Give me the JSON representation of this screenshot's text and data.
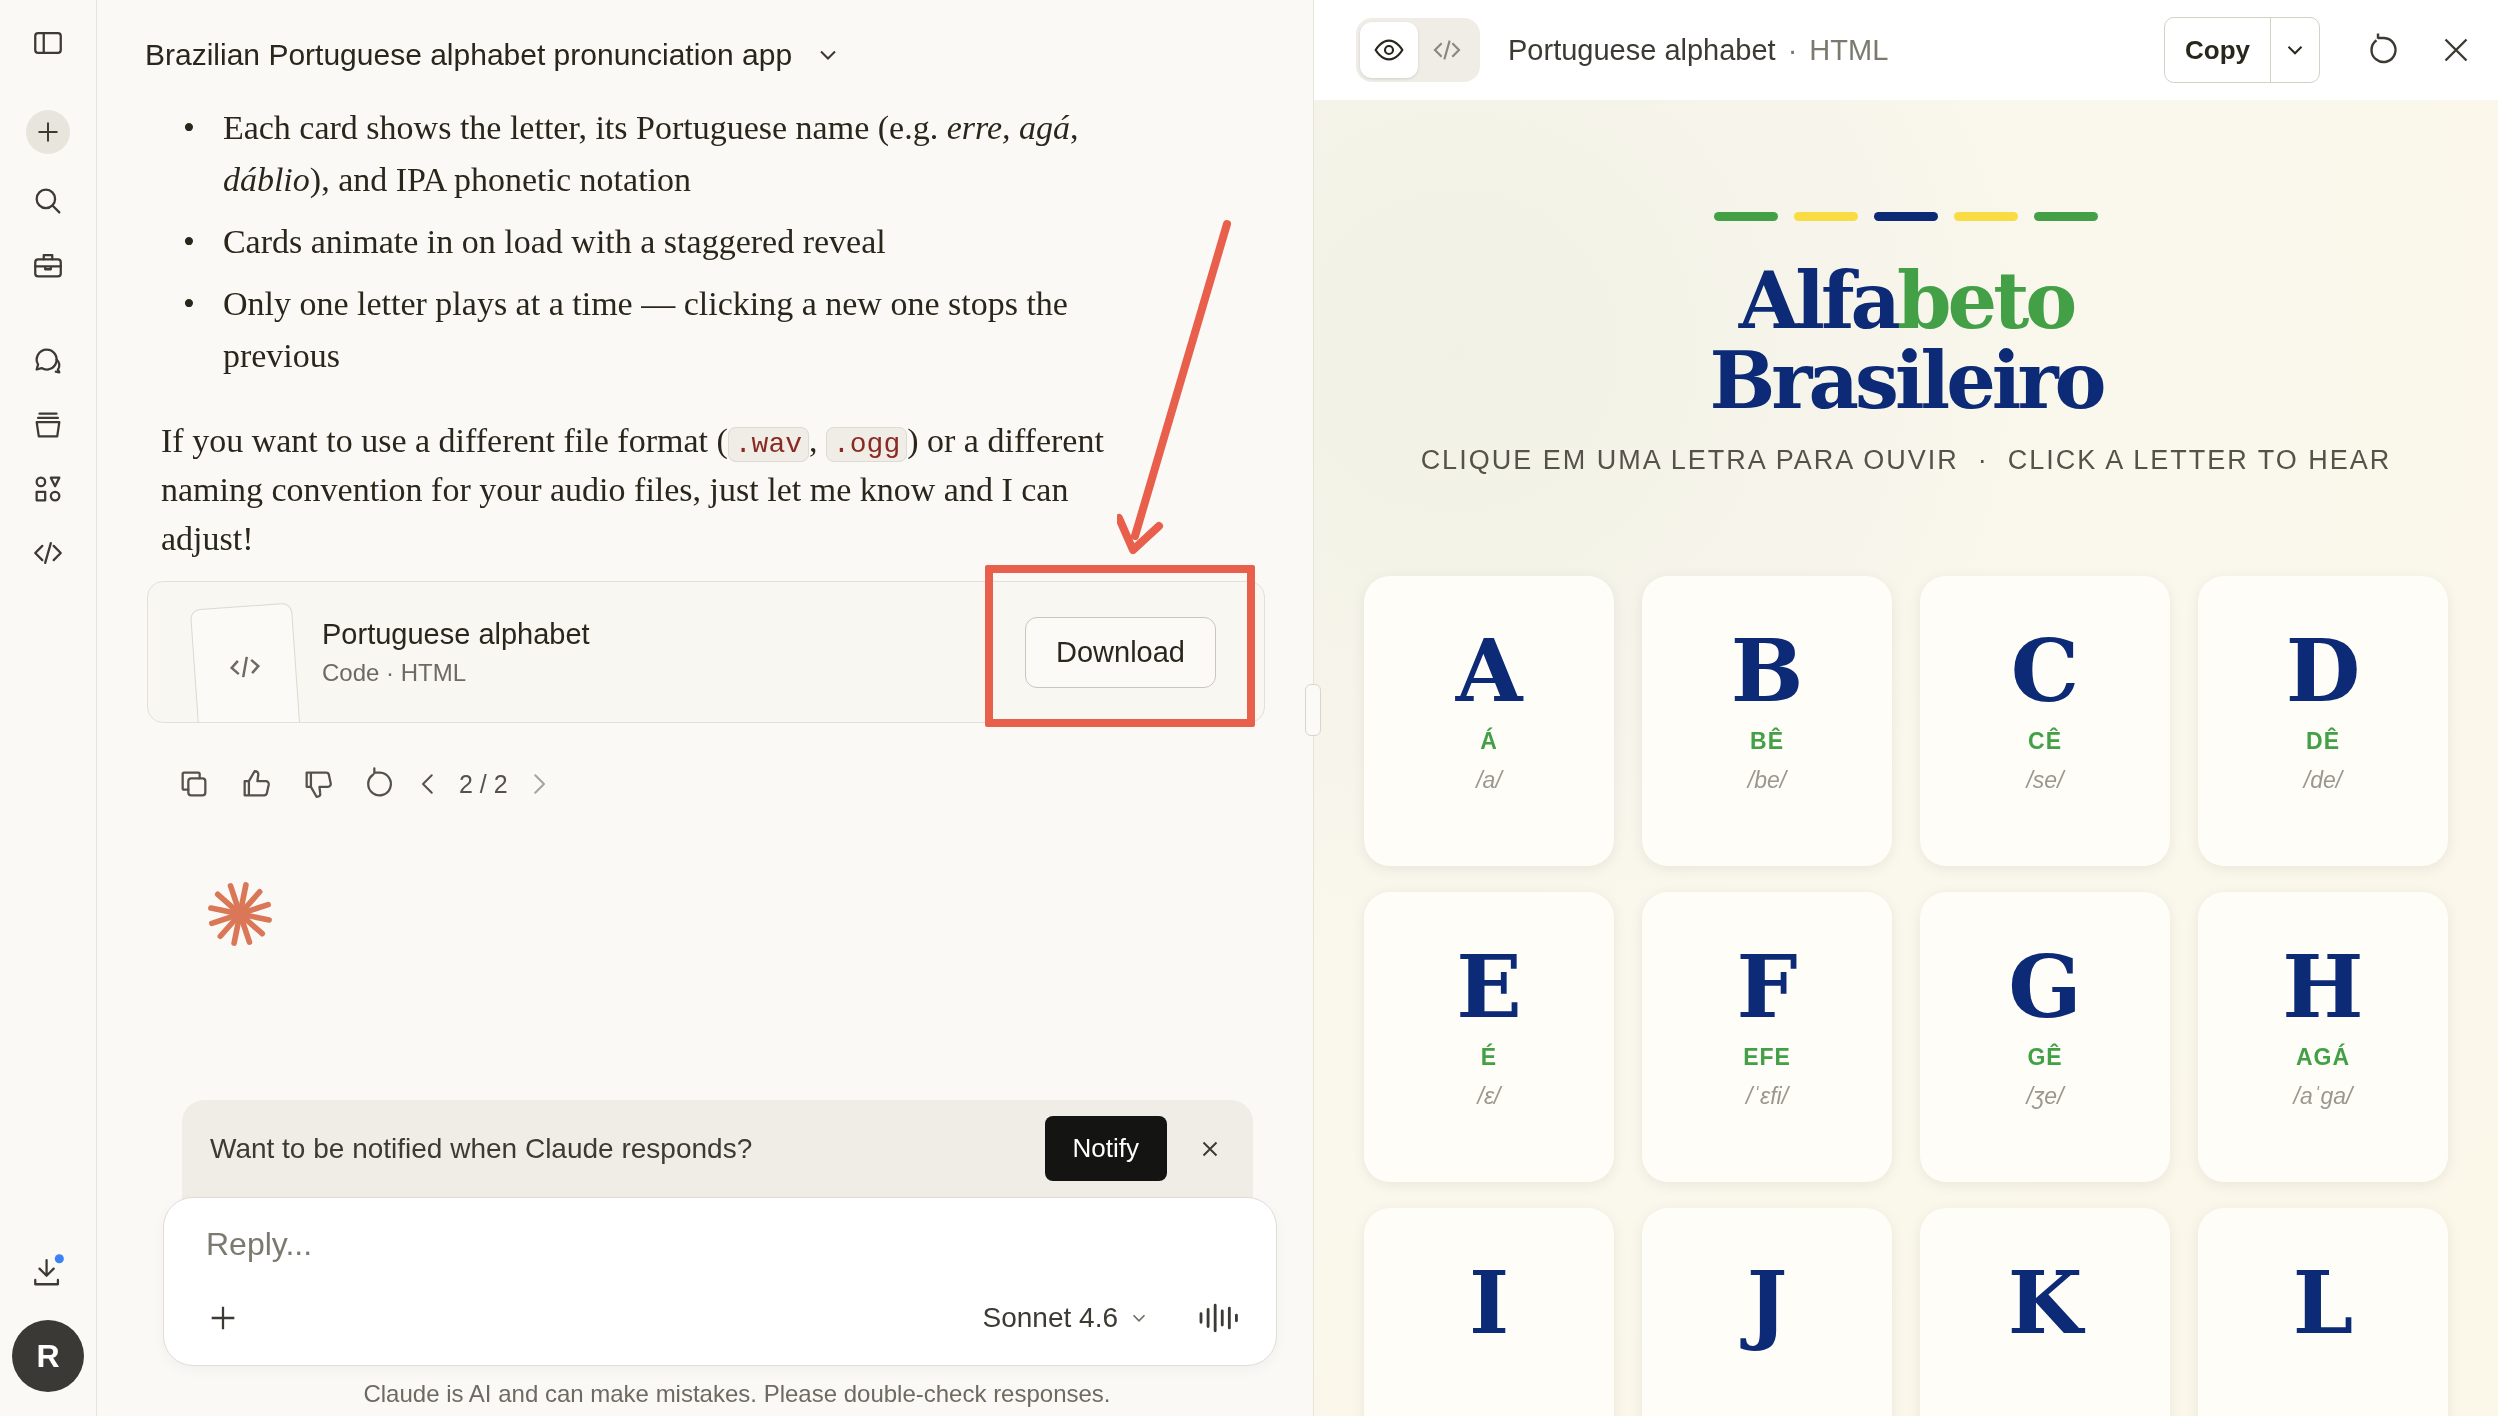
{
  "sidebar": {
    "avatar_initial": "R"
  },
  "chat": {
    "title": "Brazilian Portuguese alphabet pronunciation app",
    "bullet_marker": "•",
    "bullets": [
      "Each card shows the letter, its Portuguese name (e.g. *erre, agá*, *dáblio*), and IPA phonetic notation",
      "Cards animate in on load with a staggered reveal",
      "Only one letter plays at a time — clicking a new one stops the previous"
    ],
    "paragraph": [
      {
        "kind": "text",
        "text": "If you want to use a different file format ("
      },
      {
        "kind": "code",
        "text": ".wav"
      },
      {
        "kind": "text",
        "text": ", "
      },
      {
        "kind": "code",
        "text": ".ogg"
      },
      {
        "kind": "text",
        "text": ") or a different naming convention for your audio files, just let me know and I can adjust!"
      }
    ],
    "artifact_card": {
      "title": "Portuguese alphabet",
      "subtitle": "Code · HTML",
      "button": "Download"
    },
    "pager": "2 / 2",
    "notify_banner": {
      "text": "Want to be notified when Claude responds?",
      "button": "Notify"
    },
    "composer": {
      "placeholder": "Reply...",
      "model": "Sonnet 4.6"
    },
    "disclaimer": "Claude is AI and can make mistakes. Please double-check responses."
  },
  "artifact_panel": {
    "view_toggle": [
      {
        "kind": "preview",
        "selected": true
      },
      {
        "kind": "code",
        "selected": false
      }
    ],
    "title": "Portuguese alphabet",
    "separator": "·",
    "type": "HTML",
    "copy_button": "Copy",
    "stripes": [
      {
        "color": "#43a047"
      },
      {
        "color": "#f9dc43"
      },
      {
        "color": "#0c2a75"
      },
      {
        "color": "#f9dc43"
      },
      {
        "color": "#43a047"
      }
    ],
    "heading": [
      {
        "text": "Alfa",
        "accent": false
      },
      {
        "text": "beto",
        "accent": true
      },
      {
        "text": "Brasileiro",
        "accent": false,
        "new_line": true
      }
    ],
    "subtitle": "CLIQUE EM UMA LETRA PARA OUVIR  ·  CLICK A LETTER TO HEAR",
    "cards": [
      {
        "letter": "A",
        "name": "Á",
        "ipa": "/a/"
      },
      {
        "letter": "B",
        "name": "BÊ",
        "ipa": "/be/"
      },
      {
        "letter": "C",
        "name": "CÊ",
        "ipa": "/se/"
      },
      {
        "letter": "D",
        "name": "DÊ",
        "ipa": "/de/"
      },
      {
        "letter": "E",
        "name": "É",
        "ipa": "/ɛ/"
      },
      {
        "letter": "F",
        "name": "EFE",
        "ipa": "/ˈɛfi/"
      },
      {
        "letter": "G",
        "name": "GÊ",
        "ipa": "/ʒe/"
      },
      {
        "letter": "H",
        "name": "AGÁ",
        "ipa": "/aˈga/"
      },
      {
        "letter": "I"
      },
      {
        "letter": "J"
      },
      {
        "letter": "K"
      },
      {
        "letter": "L"
      }
    ]
  }
}
